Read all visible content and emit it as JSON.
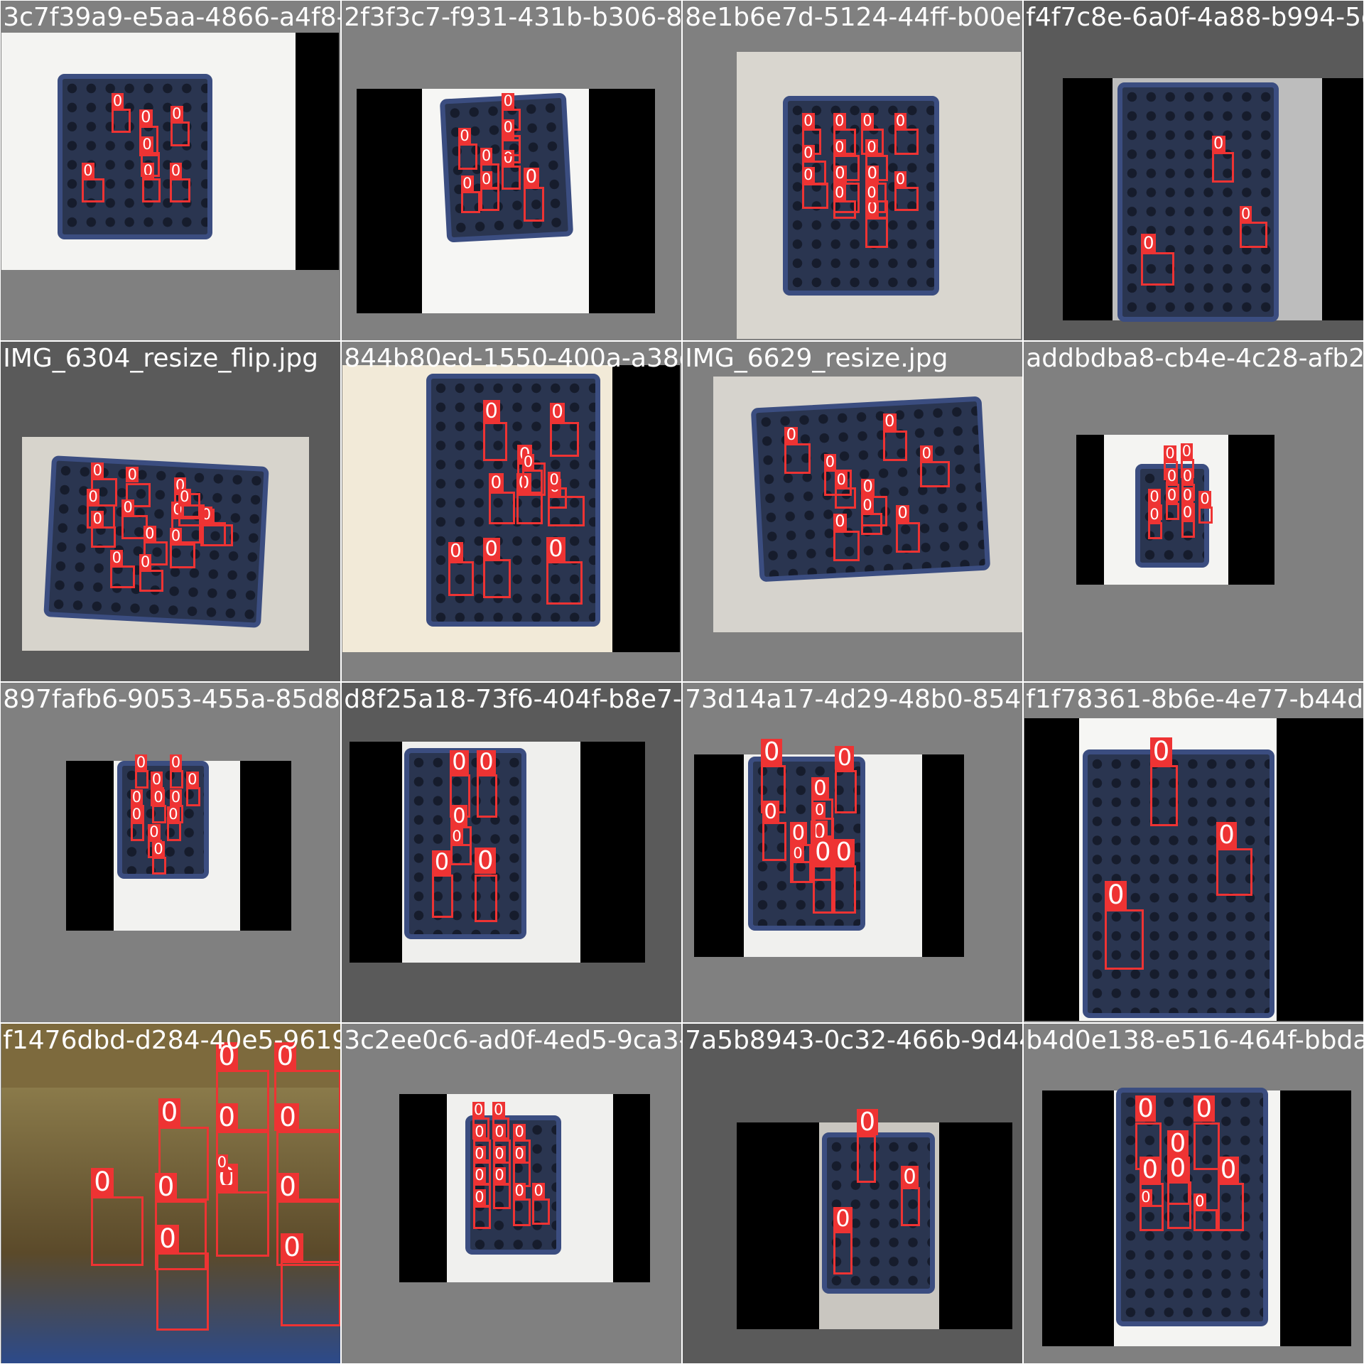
{
  "box_label": "0",
  "colors": {
    "box": "#ee3333",
    "tile_bg": "#808080",
    "tile_bg_dark": "#5a5a5a",
    "crate": "#2a3550",
    "black_bar": "#000000"
  },
  "tiles": [
    {
      "filename": "3c7f39a9-e5aa-4866-a4f8-6c2b3af031ba.jpg",
      "boxes": 7
    },
    {
      "filename": "2f3f3c7-f931-431b-b306-8b8b5b8d88b3.jpg",
      "boxes": 9
    },
    {
      "filename": "8e1b6e7d-5124-44ff-b00e-4ad3d7de7a30.jpg",
      "boxes": 14
    },
    {
      "filename": "f4f7c8e-6a0f-4a88-b994-5dfd8ddea3f6.jpg",
      "boxes": 3
    },
    {
      "filename": "IMG_6304_resize_flip.jpg",
      "boxes": 14
    },
    {
      "filename": "844b80ed-1550-400a-a38d-6b4f3dd3f32e.jpg",
      "boxes": 11
    },
    {
      "filename": "IMG_6629_resize.jpg",
      "boxes": 9
    },
    {
      "filename": "addbdba8-cb4e-4c28-afb2-e5b6d5f7c1a0.jpg",
      "boxes": 10
    },
    {
      "filename": "897fafb6-9053-455a-85d8-f4a8f26a1a07.jpg",
      "boxes": 11
    },
    {
      "filename": "d8f25a18-73f6-404f-b8e7-f8c3e4a37a5e.jpg",
      "boxes": 6
    },
    {
      "filename": "73d14a17-4d29-48b0-8540-1f3b7660f78b.jpg",
      "boxes": 10
    },
    {
      "filename": "f1f78361-8b6e-4e77-b44d-4fabf6ad0e7c.jpg",
      "boxes": 3
    },
    {
      "filename": "f1476dbd-d284-40e5-9619-f38266557bdf.jpg",
      "boxes": 12
    },
    {
      "filename": "3c2ee0c6-ad0f-4ed5-9ca3-c7358894379c.jpg",
      "boxes": 13
    },
    {
      "filename": "7a5b8943-0c32-466b-9d44-b4900f338625.jpg",
      "boxes": 3
    },
    {
      "filename": "b4d0e138-e516-464f-bbda-a0c6d3f5e2a1.jpg",
      "boxes": 8
    }
  ]
}
